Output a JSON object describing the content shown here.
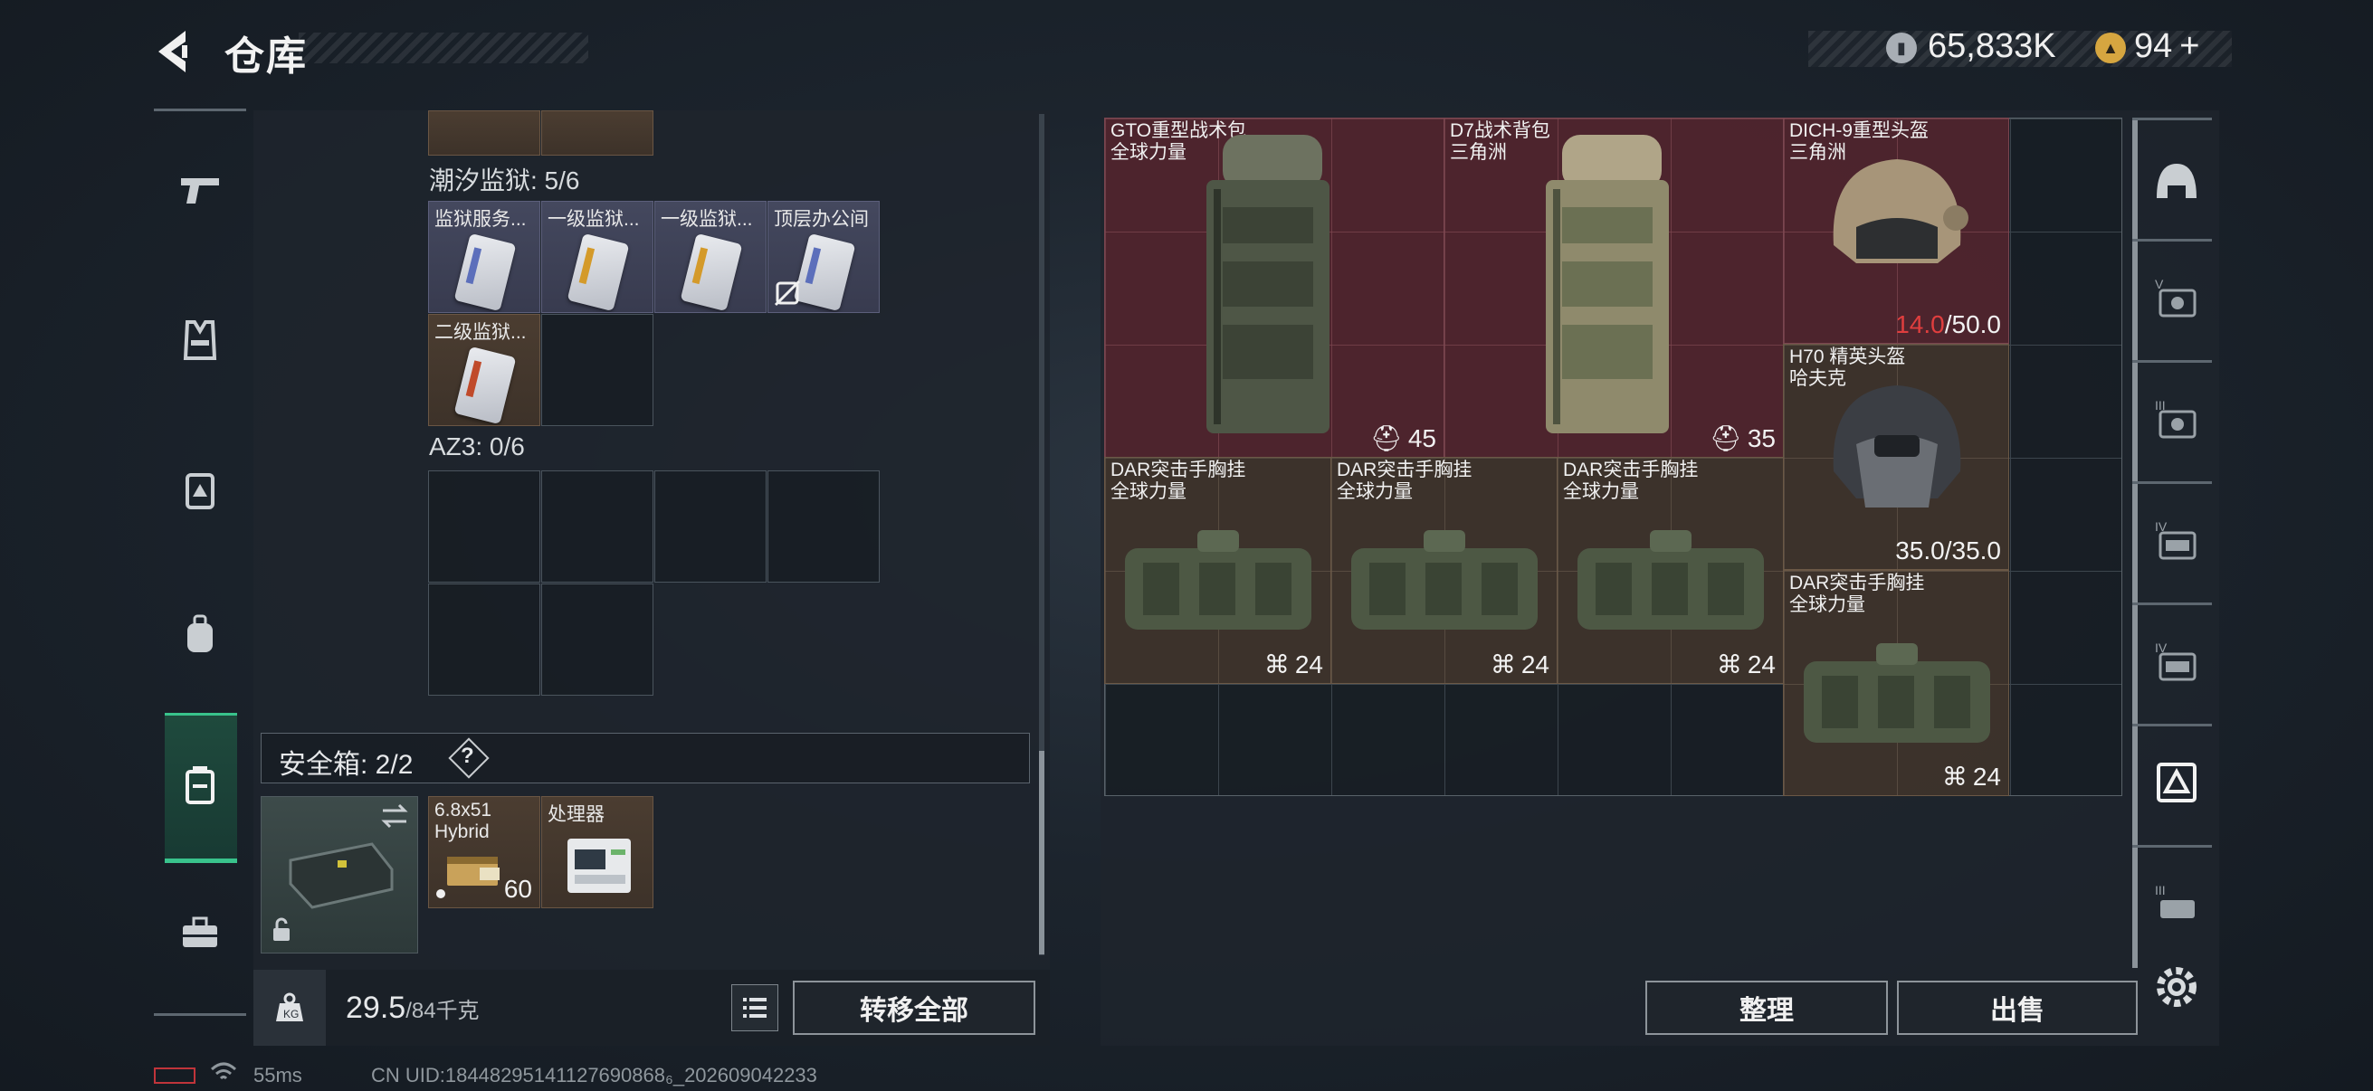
{
  "header": {
    "title": "仓库",
    "money": "65,833K",
    "gold": "94",
    "add_symbol": "+"
  },
  "left_rail": {
    "items": [
      "pistol-icon",
      "vest-icon",
      "chest-rig-icon",
      "backpack-icon",
      "safe-box-icon",
      "toolbox-icon"
    ],
    "active": "safe-box-icon"
  },
  "containers": {
    "prison": {
      "label": "潮汐监狱: 5/6",
      "cards": [
        {
          "label": "监狱服务...",
          "strip": "blue"
        },
        {
          "label": "一级监狱...",
          "strip": "orange"
        },
        {
          "label": "一级监狱...",
          "strip": "orange"
        },
        {
          "label": "顶层办公间",
          "strip": "blue"
        },
        {
          "label": "二级监狱...",
          "strip": "red"
        }
      ]
    },
    "az3": {
      "label": "AZ3: 0/6"
    },
    "safe_box": {
      "label": "安全箱: 2/2",
      "help": "?",
      "items": [
        {
          "label": "6.8x51 Hybrid",
          "count": "60"
        },
        {
          "label": "处理器",
          "count": ""
        }
      ]
    }
  },
  "weight": {
    "current": "29.5",
    "max": "/84千克"
  },
  "buttons": {
    "transfer_all": "转移全部",
    "sort": "整理",
    "sell": "出售"
  },
  "stash": {
    "items": [
      {
        "name": "GTO重型战术包",
        "sub": "全球力量",
        "count": "45",
        "type": "backpack",
        "color": "red"
      },
      {
        "name": "D7战术背包",
        "sub": "三角洲",
        "count": "35",
        "type": "backpack",
        "color": "red"
      },
      {
        "name": "DICH-9重型头盔",
        "sub": "三角洲",
        "durability_current": "14.0",
        "durability_max": "/50.0",
        "type": "helmet",
        "color": "red"
      },
      {
        "name": "H70 精英头盔",
        "sub": "哈夫克",
        "durability_current": "35.0",
        "durability_max": "/35.0",
        "type": "helmet",
        "color": "tan"
      },
      {
        "name": "DAR突击手胸挂",
        "sub": "全球力量",
        "count": "24",
        "type": "rig",
        "color": "tan"
      },
      {
        "name": "DAR突击手胸挂",
        "sub": "全球力量",
        "count": "24",
        "type": "rig",
        "color": "tan"
      },
      {
        "name": "DAR突击手胸挂",
        "sub": "全球力量",
        "count": "24",
        "type": "rig",
        "color": "tan"
      },
      {
        "name": "DAR突击手胸挂",
        "sub": "全球力量",
        "count": "24",
        "type": "rig",
        "color": "tan"
      }
    ]
  },
  "right_rail": {
    "items": [
      "helmet-filter-icon",
      "armor-v-icon",
      "armor-iii-icon",
      "armor-iv-icon",
      "armor-iv-b-icon",
      "chest-rig-filter-icon",
      "armor-iii-b-icon",
      "settings-icon"
    ],
    "active": "chest-rig-filter-icon"
  },
  "status": {
    "ping": "55ms",
    "uid": "CN UID:18448295141127690868₆_202609042233"
  },
  "colors": {
    "accent_green": "#39c38c",
    "danger_red": "#e03e3e"
  }
}
